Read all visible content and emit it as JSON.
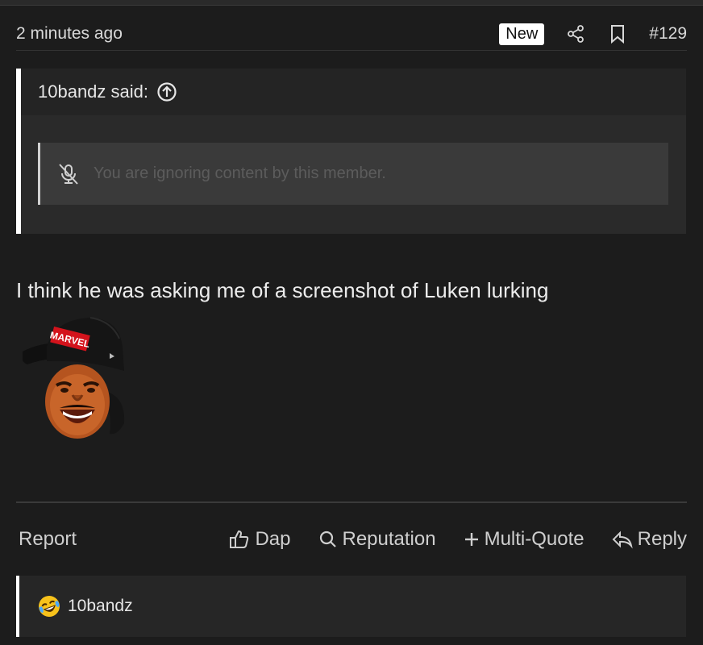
{
  "post": {
    "time": "2 minutes ago",
    "new_label": "New",
    "number": "#129",
    "body": "I think he was asking me of a screenshot of Luken lurking"
  },
  "quote": {
    "author_said": "10bandz said:",
    "ignored_text": "You are ignoring content by this member."
  },
  "actions": {
    "report": "Report",
    "dap": "Dap",
    "reputation": "Reputation",
    "multi_quote": "Multi-Quote",
    "reply": "Reply"
  },
  "reactions": {
    "user": "10bandz",
    "emoji": "laughing-crying-emoji"
  },
  "icons": {
    "share": "share-icon",
    "bookmark": "bookmark-icon",
    "up": "arrow-up-circle-icon",
    "muted": "mic-muted-icon",
    "thumb": "thumbs-up-icon",
    "search": "search-icon",
    "plus": "plus-icon",
    "reply": "reply-icon"
  },
  "avatar_logo": "MARVEL"
}
